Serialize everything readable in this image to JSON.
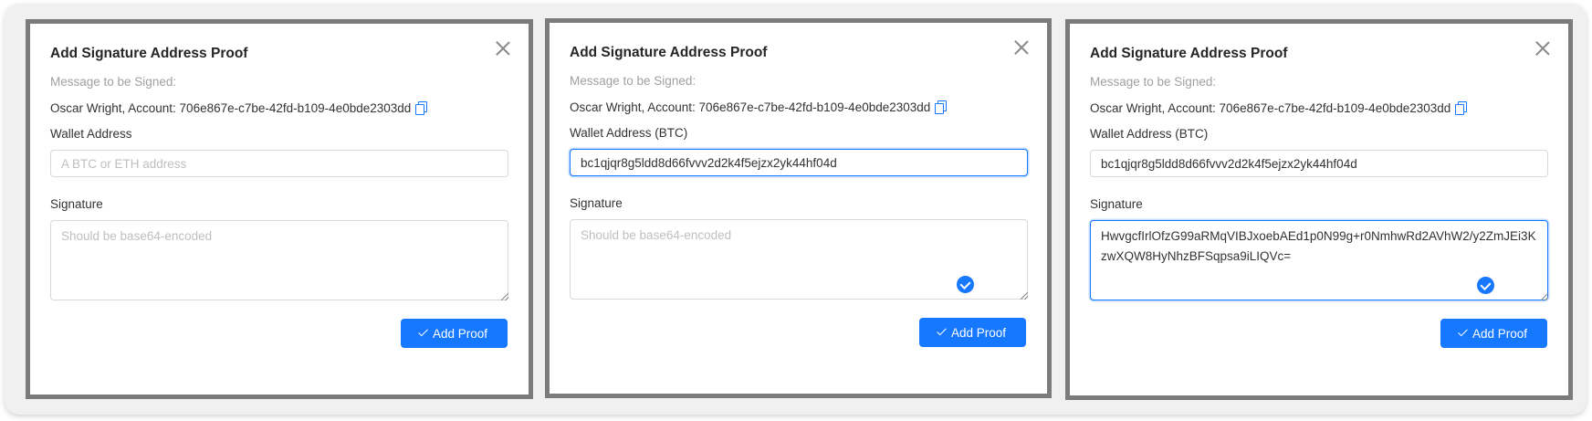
{
  "dialogs": [
    {
      "title": "Add Signature Address Proof",
      "message_label": "Message to be Signed:",
      "message_value": "Oscar Wright, Account: 706e867e-c7be-42fd-b109-4e0bde2303dd",
      "wallet_label": "Wallet Address",
      "wallet_value": "",
      "wallet_placeholder": "A BTC or ETH address",
      "signature_label": "Signature",
      "signature_value": "",
      "signature_placeholder": "Should be base64-encoded",
      "button_label": "Add Proof"
    },
    {
      "title": "Add Signature Address Proof",
      "message_label": "Message to be Signed:",
      "message_value": "Oscar Wright, Account: 706e867e-c7be-42fd-b109-4e0bde2303dd",
      "wallet_label": "Wallet Address (BTC)",
      "wallet_value": "bc1qjqr8g5ldd8d66fvvv2d2k4f5ejzx2yk44hf04d",
      "wallet_placeholder": "A BTC or ETH address",
      "signature_label": "Signature",
      "signature_value": "",
      "signature_placeholder": "Should be base64-encoded",
      "button_label": "Add Proof"
    },
    {
      "title": "Add Signature Address Proof",
      "message_label": "Message to be Signed:",
      "message_value": "Oscar Wright, Account: 706e867e-c7be-42fd-b109-4e0bde2303dd",
      "wallet_label": "Wallet Address (BTC)",
      "wallet_value": "bc1qjqr8g5ldd8d66fvvv2d2k4f5ejzx2yk44hf04d",
      "wallet_placeholder": "A BTC or ETH address",
      "signature_label": "Signature",
      "signature_value": "HwvgcfIrlOfzG99aRMqVIBJxoebAEd1p0N99g+r0NmhwRd2AVhW2/y2ZmJEi3KzwXQW8HyNhzBFSqpsa9iLIQVc=",
      "signature_placeholder": "Should be base64-encoded",
      "button_label": "Add Proof"
    }
  ],
  "colors": {
    "primary": "#1677ff",
    "panel_border": "#7b7b7b",
    "background": "#f0f0f0"
  }
}
